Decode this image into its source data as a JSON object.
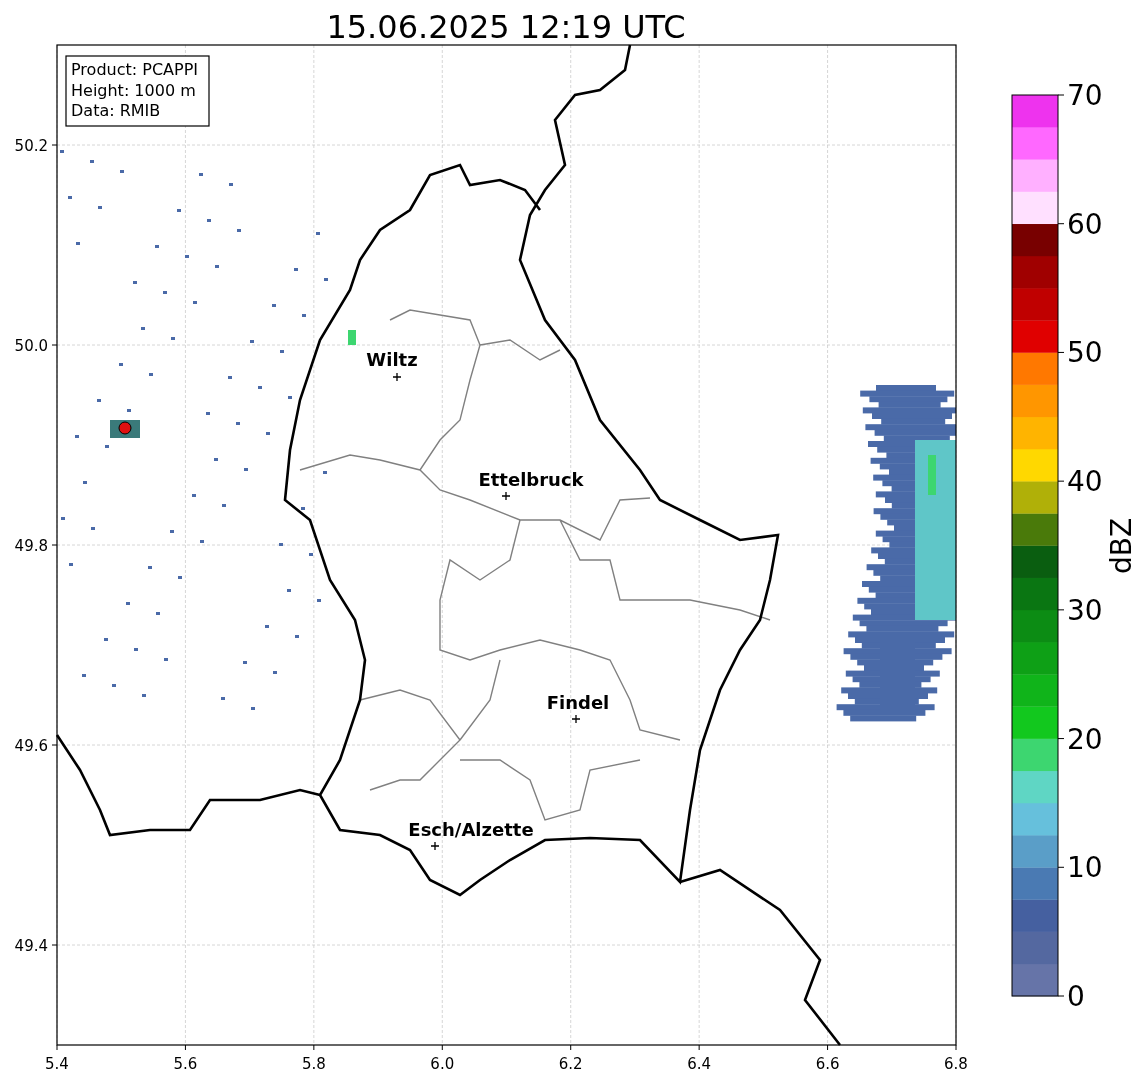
{
  "title": "15.06.2025 12:19 UTC",
  "info_box": [
    "Product: PCAPPI",
    "Height: 1000 m",
    "Data: RMIB"
  ],
  "x_ticks": [
    "5.4",
    "5.6",
    "5.8",
    "6.0",
    "6.2",
    "6.4",
    "6.6",
    "6.8"
  ],
  "y_ticks": [
    "50.2",
    "50.0",
    "49.8",
    "49.6",
    "49.4"
  ],
  "cities": [
    {
      "name": "Wiltz"
    },
    {
      "name": "Ettelbruck"
    },
    {
      "name": "Findel"
    },
    {
      "name": "Esch/Alzette"
    }
  ],
  "colorbar": {
    "label": "dBZ",
    "ticks": [
      "70",
      "60",
      "50",
      "40",
      "30",
      "20",
      "10",
      "0"
    ],
    "bins": [
      {
        "color": "#6674a8"
      },
      {
        "color": "#5468a0"
      },
      {
        "color": "#4560a0"
      },
      {
        "color": "#4a7ab3"
      },
      {
        "color": "#5a9ec8"
      },
      {
        "color": "#66c0dc"
      },
      {
        "color": "#5fd6c4"
      },
      {
        "color": "#3dd670"
      },
      {
        "color": "#12c81e"
      },
      {
        "color": "#10b41a"
      },
      {
        "color": "#0ea016"
      },
      {
        "color": "#0c8c14"
      },
      {
        "color": "#0a7612"
      },
      {
        "color": "#0a5e10"
      },
      {
        "color": "#4a7a0a"
      },
      {
        "color": "#b0b008"
      },
      {
        "color": "#ffd800"
      },
      {
        "color": "#ffb400"
      },
      {
        "color": "#ff9600"
      },
      {
        "color": "#ff7800"
      },
      {
        "color": "#e00000"
      },
      {
        "color": "#c00000"
      },
      {
        "color": "#a00000"
      },
      {
        "color": "#780000"
      },
      {
        "color": "#ffe0ff"
      },
      {
        "color": "#ffb0ff"
      },
      {
        "color": "#ff68ff"
      },
      {
        "color": "#ee33ee"
      }
    ]
  }
}
